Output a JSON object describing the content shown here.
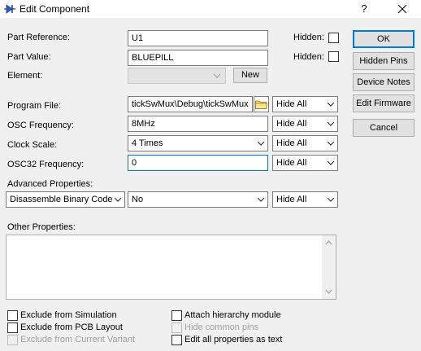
{
  "window": {
    "title": "Edit Component",
    "help_glyph": "?",
    "close_glyph": "✕"
  },
  "fields": {
    "part_reference": {
      "label": "Part Reference:",
      "value": "U1",
      "hidden_label": "Hidden:"
    },
    "part_value": {
      "label": "Part Value:",
      "value": "BLUEPILL",
      "hidden_label": "Hidden:"
    },
    "element": {
      "label": "Element:",
      "value": "",
      "new_label": "New"
    },
    "program_file": {
      "label": "Program File:",
      "value": "tickSwMux\\Debug\\tickSwMux",
      "visibility": "Hide All"
    },
    "osc_frequency": {
      "label": "OSC Frequency:",
      "value": "8MHz",
      "visibility": "Hide All"
    },
    "clock_scale": {
      "label": "Clock Scale:",
      "value": "4 Times",
      "visibility": "Hide All"
    },
    "osc32_frequency": {
      "label": "OSC32 Frequency:",
      "value": "0",
      "visibility": "Hide All"
    }
  },
  "advanced": {
    "label": "Advanced Properties:",
    "property": "Disassemble Binary Code",
    "value": "No",
    "visibility": "Hide All"
  },
  "other": {
    "label": "Other Properties:",
    "text": ""
  },
  "options": {
    "exclude_simulation": "Exclude from Simulation",
    "exclude_pcb": "Exclude from PCB Layout",
    "exclude_variant": "Exclude from Current Variant",
    "attach_hierarchy": "Attach hierarchy module",
    "hide_common_pins": "Hide common pins",
    "edit_all_props": "Edit all properties as text"
  },
  "buttons": {
    "ok": "OK",
    "hidden_pins": "Hidden Pins",
    "device_notes": "Device Notes",
    "edit_firmware": "Edit Firmware",
    "cancel": "Cancel"
  },
  "colors": {
    "accent": "#0078d7",
    "background": "#f0f0f0"
  }
}
